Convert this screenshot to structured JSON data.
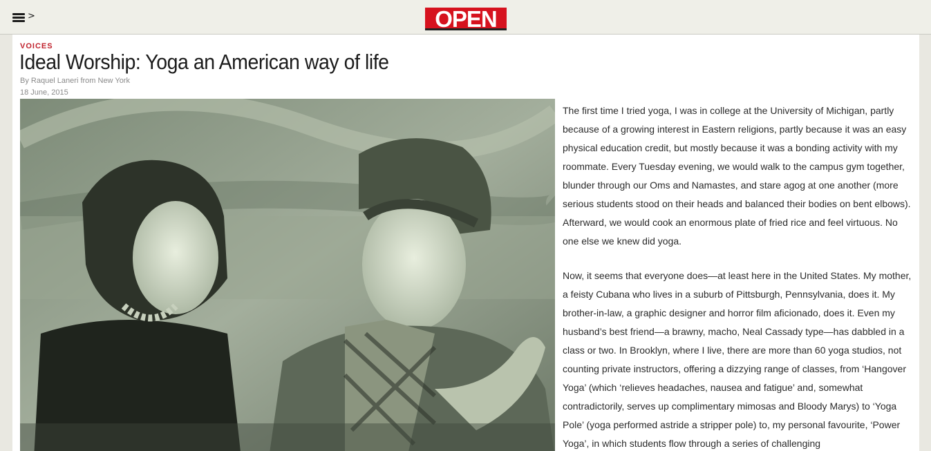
{
  "header": {
    "logo_text": "OPEN",
    "menu_icon": "hamburger-menu-icon",
    "menu_chevron": ">"
  },
  "article": {
    "section": "VOICES",
    "title": "Ideal Worship: Yoga an American way of life",
    "byline": "By Raquel Laneri from New York",
    "date": "18 June, 2015",
    "photo_alt": "Photo of two women laughing together",
    "paragraphs": [
      "The first time I tried yoga, I was in college at the University of Michigan, partly because of a growing interest in Eastern religions, partly because it was an easy physical education credit, but mostly because it was a bonding activity with my roommate. Every Tuesday evening, we would walk to the campus gym together, blunder through our Oms and Namastes, and stare agog at one another (more serious students stood on their heads and balanced their bodies on bent elbows). Afterward, we would cook an enormous plate of fried rice and feel virtuous. No one else we knew did yoga.",
      "Now, it seems that everyone does—at least here in the United States. My mother, a feisty Cubana who lives in a suburb of Pittsburgh, Pennsylvania, does it. My brother-in-law, a graphic designer and horror film aficionado, does it. Even my husband’s best friend—a brawny, macho, Neal Cassady type—has dabbled in a class or two. In Brooklyn, where I live, there are more than 60 yoga studios, not counting private instructors, offering a dizzying range of classes, from ‘Hangover Yoga’ (which ‘relieves headaches, nausea and fatigue’ and, somewhat contradictorily, serves up complimentary mimosas and Bloody Marys) to ‘Yoga Pole’ (yoga performed astride a stripper pole) to, my personal favourite, ‘Power Yoga’, in which students flow through a series of challenging"
    ]
  },
  "colors": {
    "accent": "#c0202b",
    "logo_bg": "#d6121e",
    "page_bg": "#e9e8e1",
    "photo_tint": "#8e9a86"
  }
}
